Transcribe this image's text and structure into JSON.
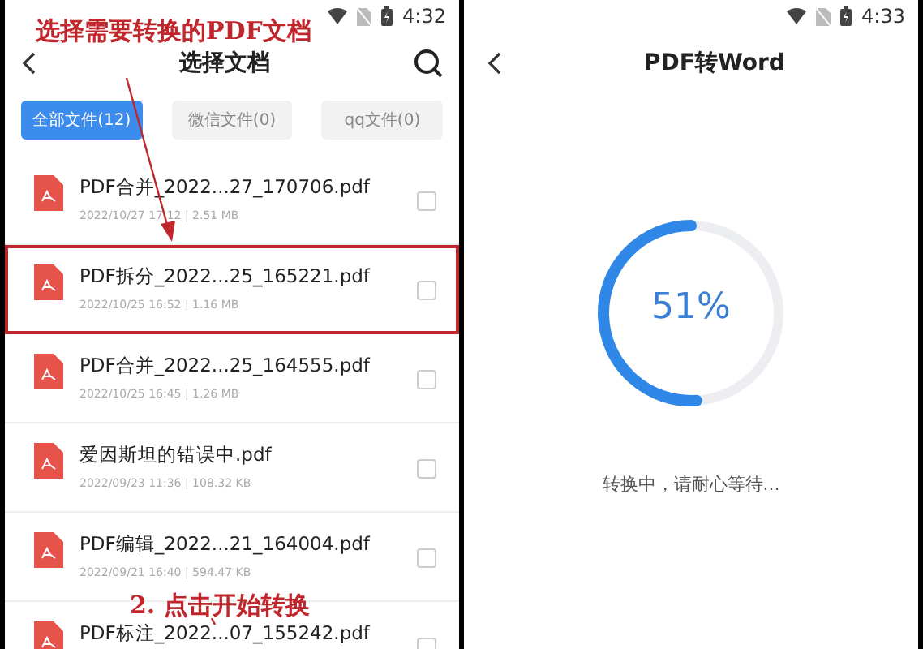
{
  "left_screen": {
    "status_bar": {
      "time": "4:32"
    },
    "title": "选择文档",
    "tabs": [
      {
        "label": "全部文件(12)",
        "selected": true
      },
      {
        "label": "微信文件(0)",
        "selected": false
      },
      {
        "label": "qq文件(0)",
        "selected": false
      }
    ],
    "files": [
      {
        "name": "PDF合并_2022...27_170706.pdf",
        "meta": "2022/10/27 17:12 | 2.51 MB",
        "checked": false,
        "highlighted": false
      },
      {
        "name": "PDF拆分_2022...25_165221.pdf",
        "meta": "2022/10/25 16:52 | 1.16 MB",
        "checked": false,
        "highlighted": true
      },
      {
        "name": "PDF合并_2022...25_164555.pdf",
        "meta": "2022/10/25 16:45 | 1.26 MB",
        "checked": false,
        "highlighted": false
      },
      {
        "name": "爱因斯坦的错误中.pdf",
        "meta": "2022/09/23 11:36 | 108.32 KB",
        "checked": false,
        "highlighted": false
      },
      {
        "name": "PDF编辑_2022...21_164004.pdf",
        "meta": "2022/09/21 16:40 | 594.47 KB",
        "checked": false,
        "highlighted": false
      },
      {
        "name": "PDF标注_2022...07_155242.pdf",
        "checked": false,
        "highlighted": false
      }
    ]
  },
  "right_screen": {
    "status_bar": {
      "time": "4:33"
    },
    "title": "PDF转Word",
    "progress": {
      "level": 0.51,
      "reading": "51%"
    },
    "message": "转换中，请耐心等待..."
  },
  "annotations": [
    "选择需要转换的PDF文档",
    "2. 点击开始转换"
  ]
}
